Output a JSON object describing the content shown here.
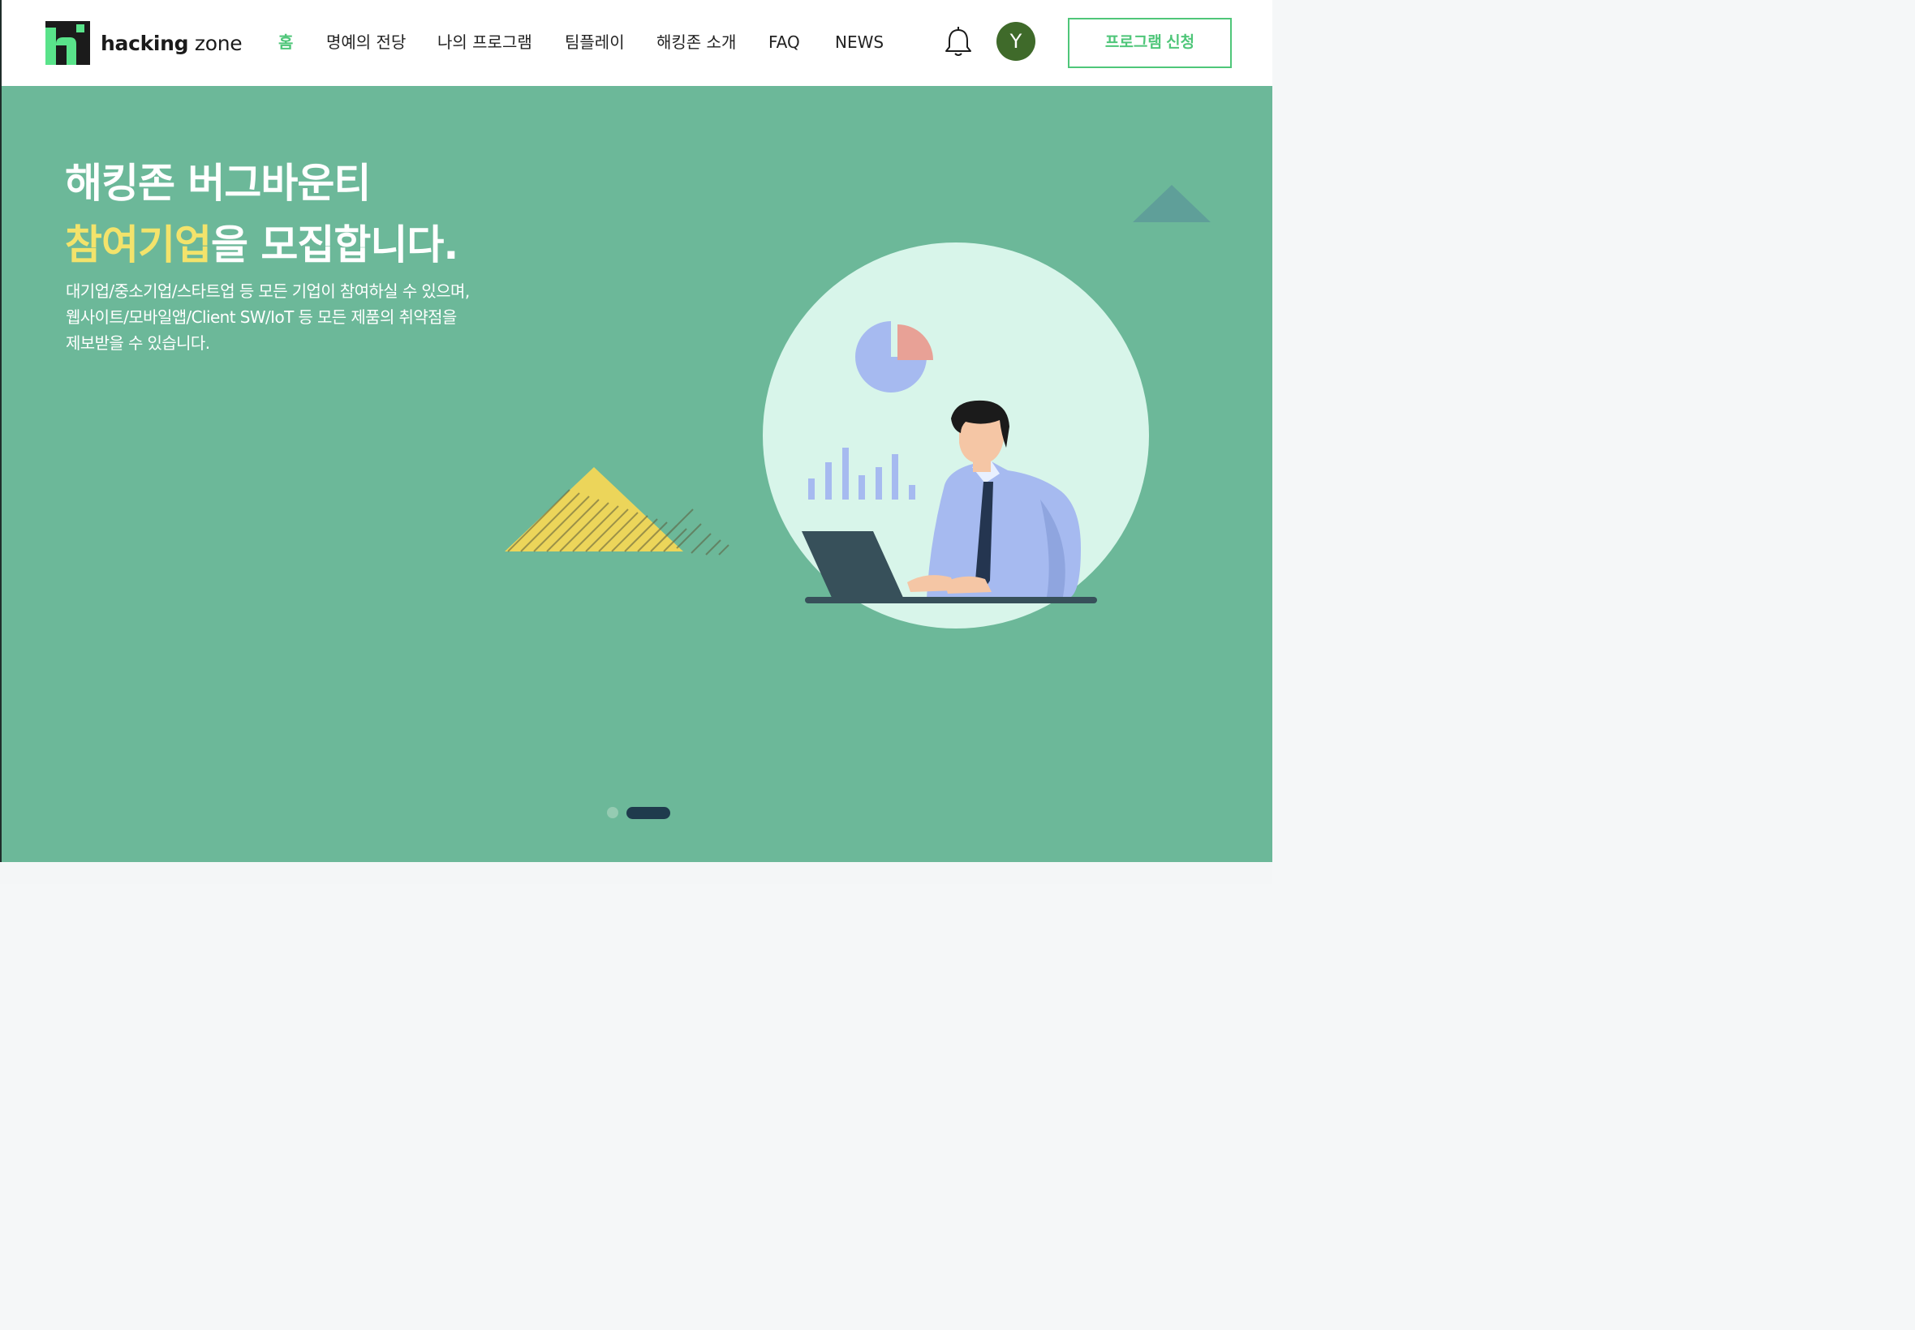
{
  "brand": {
    "name_bold": "hacking",
    "name_light": " zone"
  },
  "nav": {
    "items": [
      {
        "label": "홈",
        "active": true
      },
      {
        "label": "명예의 전당"
      },
      {
        "label": "나의 프로그램"
      },
      {
        "label": "팀플레이"
      },
      {
        "label": "해킹존 소개"
      },
      {
        "label": "FAQ"
      },
      {
        "label": "NEWS"
      }
    ]
  },
  "header": {
    "notification_icon": "bell-icon",
    "avatar_letter": "Y",
    "apply_label": "프로그램 신청"
  },
  "hero": {
    "title_line1": "해킹존 버그바운티",
    "title_highlight": "참여기업",
    "title_line2_rest": "을 모집합니다.",
    "description": [
      "대기업/중소기업/스타트업 등 모든 기업이 참여하실 수 있으며,",
      "웹사이트/모바일앱/Client SW/IoT 등 모든 제품의 취약점을",
      "제보받을 수 있습니다."
    ]
  },
  "carousel": {
    "slide_count": 2,
    "active_index": 1
  },
  "colors": {
    "accent": "#4fc679",
    "hero_bg": "#6cb899",
    "highlight": "#f3e36b",
    "avatar_bg": "#3f6a2a",
    "indicator_active": "#1f3b4d"
  }
}
